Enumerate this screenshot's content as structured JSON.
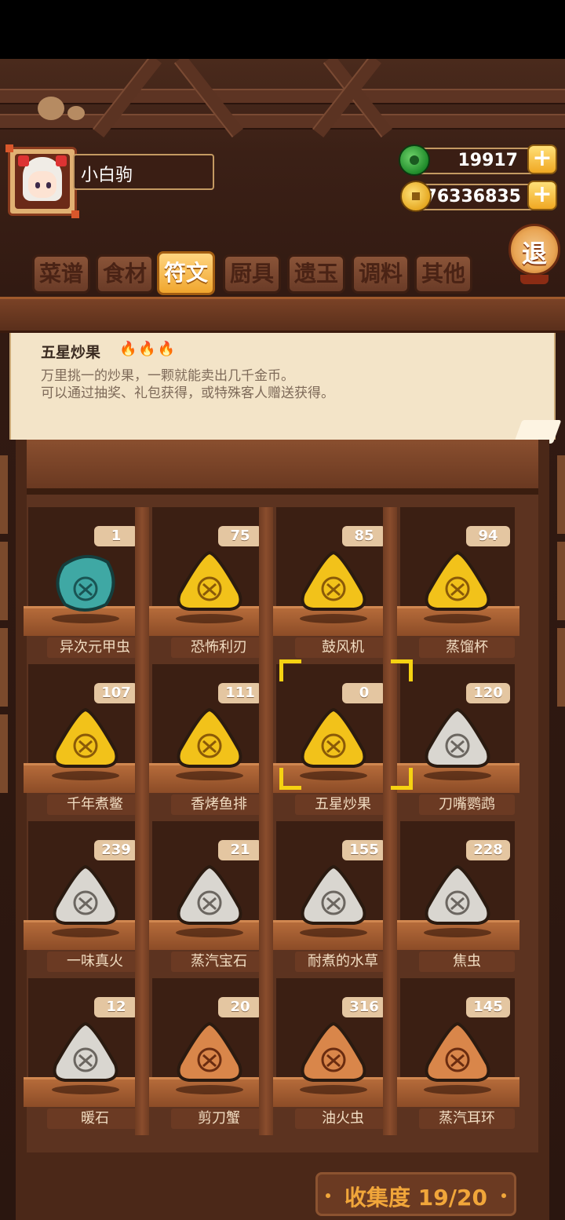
{
  "profile": {
    "name": "小白驹"
  },
  "currency": {
    "jade": "19917",
    "gold": "76336835"
  },
  "exit_label": "退",
  "tabs": [
    {
      "label": "菜谱",
      "active": false
    },
    {
      "label": "食材",
      "active": false
    },
    {
      "label": "符文",
      "active": true
    },
    {
      "label": "厨具",
      "active": false
    },
    {
      "label": "遗玉",
      "active": false
    },
    {
      "label": "调料",
      "active": false
    },
    {
      "label": "其他",
      "active": false
    }
  ],
  "selected": {
    "title": "五星炒果",
    "flames": "🔥🔥🔥",
    "line1": "万里挑一的炒果，一颗就能卖出几千金币。",
    "line2": "可以通过抽奖、礼包获得，或特殊客人赠送获得。"
  },
  "items": [
    {
      "name": "异次元甲虫",
      "count": "1",
      "color": "#3fa8a4",
      "icon": "beetle-rune-icon"
    },
    {
      "name": "恐怖利刃",
      "count": "75",
      "color": "#f2c21a",
      "icon": "antler-rune-icon"
    },
    {
      "name": "鼓风机",
      "count": "85",
      "color": "#f2c21a",
      "icon": "spiral-rune-icon"
    },
    {
      "name": "蒸馏杯",
      "count": "94",
      "color": "#f2c21a",
      "icon": "cup-rune-icon"
    },
    {
      "name": "千年煮鳖",
      "count": "107",
      "color": "#f2c21a",
      "icon": "turtle-rune-icon"
    },
    {
      "name": "香烤鱼排",
      "count": "111",
      "color": "#f2c21a",
      "icon": "fish-rune-icon"
    },
    {
      "name": "五星炒果",
      "count": "0",
      "color": "#f2c21a",
      "icon": "star-rune-icon"
    },
    {
      "name": "刀嘴鹦鹉",
      "count": "120",
      "color": "#d9d6d0",
      "icon": "parrot-rune-icon"
    },
    {
      "name": "一味真火",
      "count": "239",
      "color": "#d9d6d0",
      "icon": "leaf-rune-icon"
    },
    {
      "name": "蒸汽宝石",
      "count": "21",
      "color": "#d9d6d0",
      "icon": "gem-rune-icon"
    },
    {
      "name": "耐煮的水草",
      "count": "155",
      "color": "#d9d6d0",
      "icon": "seaweed-rune-icon"
    },
    {
      "name": "焦虫",
      "count": "228",
      "color": "#d9d6d0",
      "icon": "bug-rune-icon"
    },
    {
      "name": "暖石",
      "count": "12",
      "color": "#d9d6d0",
      "icon": "stone-rune-icon"
    },
    {
      "name": "剪刀蟹",
      "count": "20",
      "color": "#d9864a",
      "icon": "crab-rune-icon"
    },
    {
      "name": "油火虫",
      "count": "316",
      "color": "#d9864a",
      "icon": "firebug-rune-icon"
    },
    {
      "name": "蒸汽耳环",
      "count": "145",
      "color": "#d9864a",
      "icon": "earring-rune-icon"
    }
  ],
  "collection": "收集度 19/20"
}
